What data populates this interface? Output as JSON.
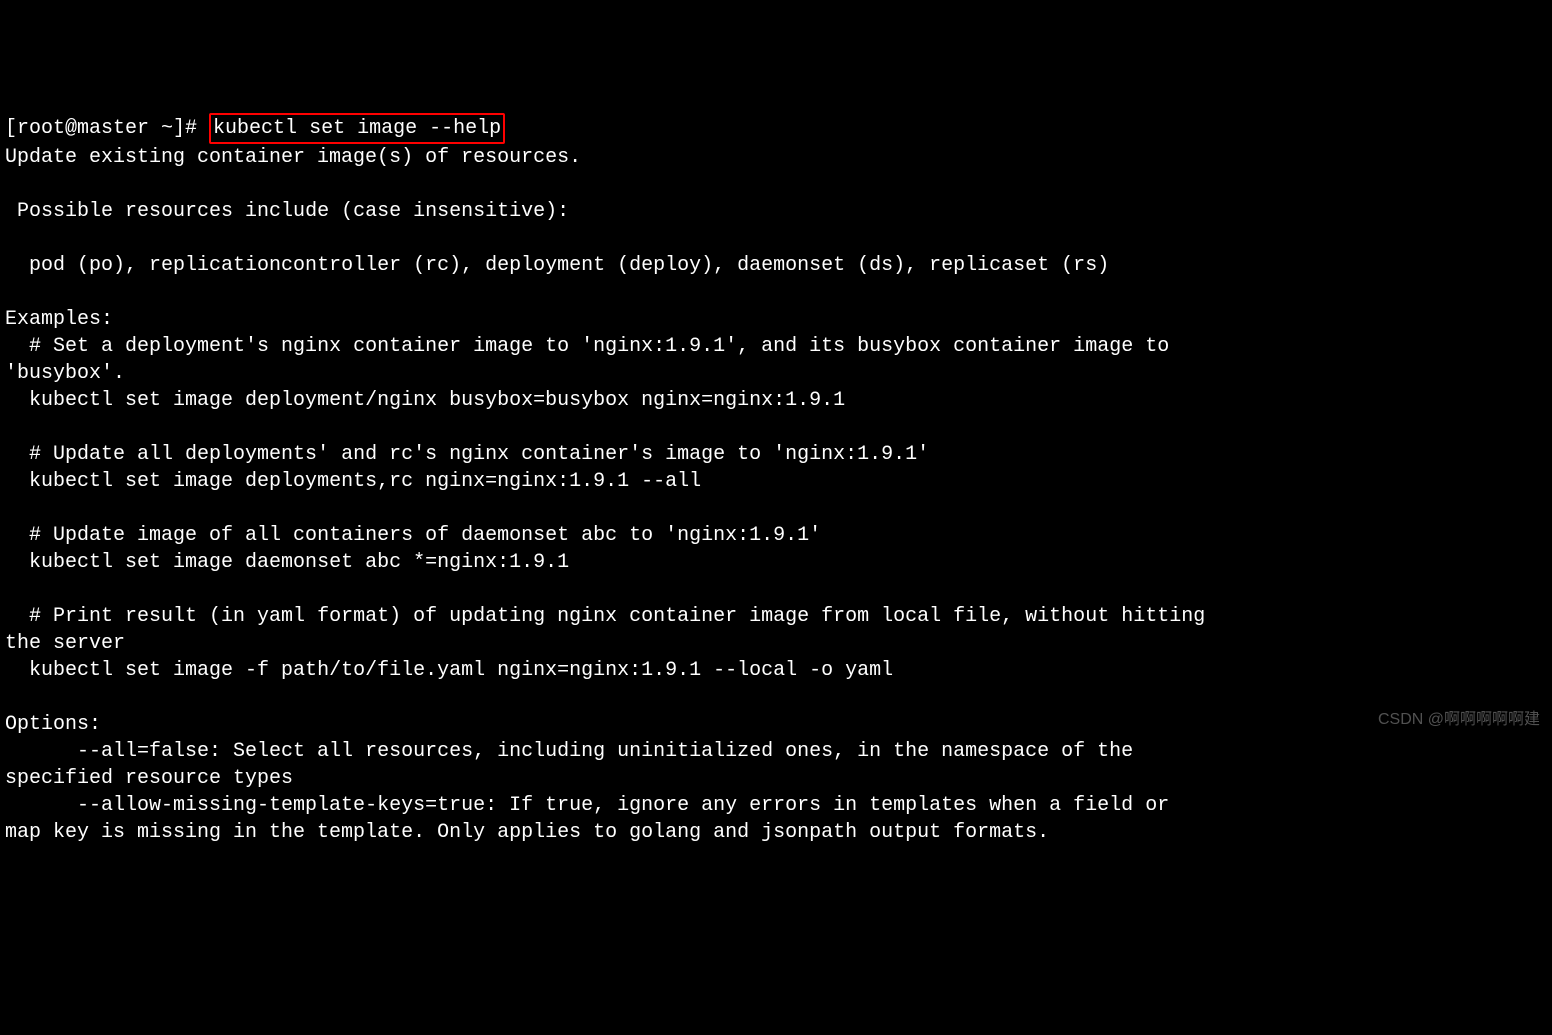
{
  "terminal": {
    "prompt": "[root@master ~]# ",
    "command": "kubectl set image --help",
    "output_line1": "Update existing container image(s) of resources.",
    "output_line2": "",
    "output_line3": " Possible resources include (case insensitive):",
    "output_line4": "",
    "output_line5": "  pod (po), replicationcontroller (rc), deployment (deploy), daemonset (ds), replicaset (rs)",
    "output_line6": "",
    "output_line7": "Examples:",
    "output_line8": "  # Set a deployment's nginx container image to 'nginx:1.9.1', and its busybox container image to",
    "output_line9": "'busybox'.",
    "output_line10": "  kubectl set image deployment/nginx busybox=busybox nginx=nginx:1.9.1",
    "output_line11": "",
    "output_line12": "  # Update all deployments' and rc's nginx container's image to 'nginx:1.9.1'",
    "output_line13": "  kubectl set image deployments,rc nginx=nginx:1.9.1 --all",
    "output_line14": "",
    "output_line15": "  # Update image of all containers of daemonset abc to 'nginx:1.9.1'",
    "output_line16": "  kubectl set image daemonset abc *=nginx:1.9.1",
    "output_line17": "",
    "output_line18": "  # Print result (in yaml format) of updating nginx container image from local file, without hitting",
    "output_line19": "the server",
    "output_line20": "  kubectl set image -f path/to/file.yaml nginx=nginx:1.9.1 --local -o yaml",
    "output_line21": "",
    "output_line22": "Options:",
    "output_line23": "      --all=false: Select all resources, including uninitialized ones, in the namespace of the",
    "output_line24": "specified resource types",
    "output_line25": "      --allow-missing-template-keys=true: If true, ignore any errors in templates when a field or",
    "output_line26": "map key is missing in the template. Only applies to golang and jsonpath output formats."
  },
  "watermark": "CSDN @啊啊啊啊啊建"
}
